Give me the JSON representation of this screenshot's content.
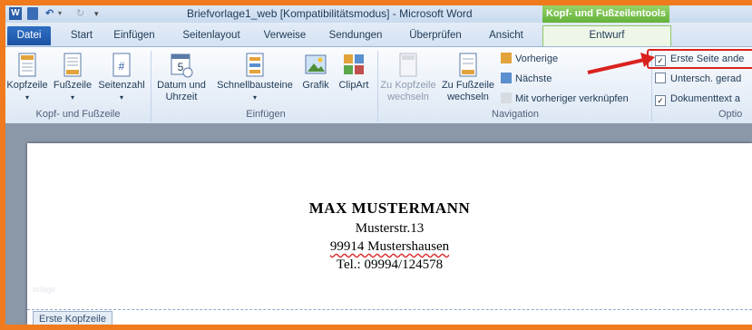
{
  "window": {
    "title": "Briefvorlage1_web [Kompatibilitätsmodus] - Microsoft Word",
    "contextual_title": "Kopf- und Fußzeilentools"
  },
  "tabs": [
    "Datei",
    "Start",
    "Einfügen",
    "Seitenlayout",
    "Verweise",
    "Sendungen",
    "Überprüfen",
    "Ansicht",
    "Entwurf"
  ],
  "ribbon": {
    "groups": {
      "kopf_fuss": "Kopf- und Fußzeile",
      "einfuegen": "Einfügen",
      "navigation": "Navigation",
      "optionen": "Optio"
    },
    "buttons": {
      "kopfzeile": "Kopfzeile",
      "fusszeile": "Fußzeile",
      "seitenzahl": "Seitenzahl",
      "datum_1": "Datum und",
      "datum_2": "Uhrzeit",
      "schnell": "Schnellbausteine",
      "grafik": "Grafik",
      "clipart": "ClipArt",
      "zu_kopf_1": "Zu Kopfzeile",
      "zu_kopf_2": "wechseln",
      "zu_fuss_1": "Zu Fußzeile",
      "zu_fuss_2": "wechseln",
      "vorherige": "Vorherige",
      "naechste": "Nächste",
      "verknuepfen": "Mit vorheriger verknüpfen"
    },
    "options": [
      {
        "label": "Erste Seite ande",
        "checked": true
      },
      {
        "label": "Untersch. gerad",
        "checked": false
      },
      {
        "label": "Dokumenttext a",
        "checked": true
      }
    ]
  },
  "document": {
    "name": "MAX MUSTERMANN",
    "street": "Musterstr.13",
    "city": "99914 Mustershausen",
    "phone": "Tel.: 09994/124578",
    "header_tag": "Erste Kopfzeile",
    "watermark": "orlage"
  },
  "colors": {
    "accent_frame": "#f07a1e",
    "datei_tab": "#1b53a5",
    "contextual_green": "#62b23a",
    "highlight_red": "#d9221f"
  }
}
